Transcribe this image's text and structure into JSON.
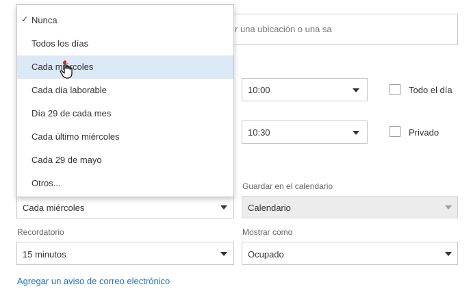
{
  "location": {
    "placeholder_partial": "r una ubicación o una sa"
  },
  "start_time": {
    "value": "10:00"
  },
  "end_time": {
    "value": "10:30"
  },
  "all_day": {
    "label": "Todo el día",
    "checked": false
  },
  "private": {
    "label": "Privado",
    "checked": false
  },
  "repeat_menu": {
    "items": [
      {
        "label": "Nunca",
        "checked": true
      },
      {
        "label": "Todos los días"
      },
      {
        "label": "Cada miércoles",
        "hovered": true
      },
      {
        "label": "Cada día laborable"
      },
      {
        "label": "Día 29 de cada mes"
      },
      {
        "label": "Cada último miércoles"
      },
      {
        "label": "Cada 29 de mayo"
      },
      {
        "label": "Otros..."
      }
    ]
  },
  "repeat": {
    "value": "Cada miércoles"
  },
  "save_calendar": {
    "label": "Guardar en el calendario",
    "value": "Calendario"
  },
  "reminder": {
    "label": "Recordatorio",
    "value": "15 minutos"
  },
  "show_as": {
    "label": "Mostrar como",
    "value": "Ocupado"
  },
  "email_link": {
    "label": "Agregar un aviso de correo electrónico"
  },
  "icons": {
    "check": "checkmark-icon",
    "caret": "chevron-down-icon",
    "cursor": "hand-pointer-icon"
  }
}
